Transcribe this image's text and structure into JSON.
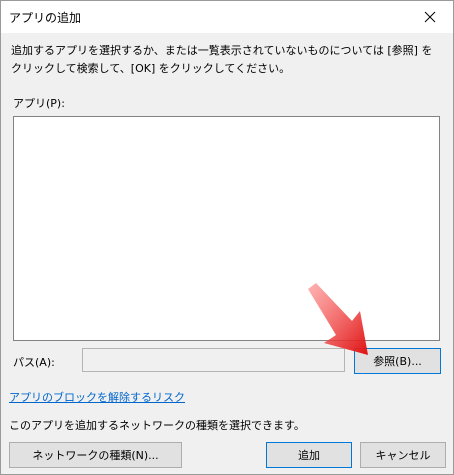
{
  "dialog": {
    "title": "アプリの追加",
    "description": "追加するアプリを選択するか、または一覧表示されていないものについては [参照] をクリックして検索して、[OK] をクリックしてください。",
    "list_label": "アプリ(P):",
    "path_label": "パス(A):",
    "path_value": "",
    "browse_label": "参照(B)...",
    "risk_link": "アプリのブロックを解除するリスク",
    "network_info": "このアプリを追加するネットワークの種類を選択できます。",
    "network_button": "ネットワークの種類(N)...",
    "add_button": "追加",
    "cancel_button": "キャンセル"
  },
  "icons": {
    "close": "close-icon",
    "annotation": "red-arrow-icon"
  },
  "colors": {
    "accent_border": "#0078d7",
    "link": "#0066cc",
    "arrow": "#e01010"
  }
}
